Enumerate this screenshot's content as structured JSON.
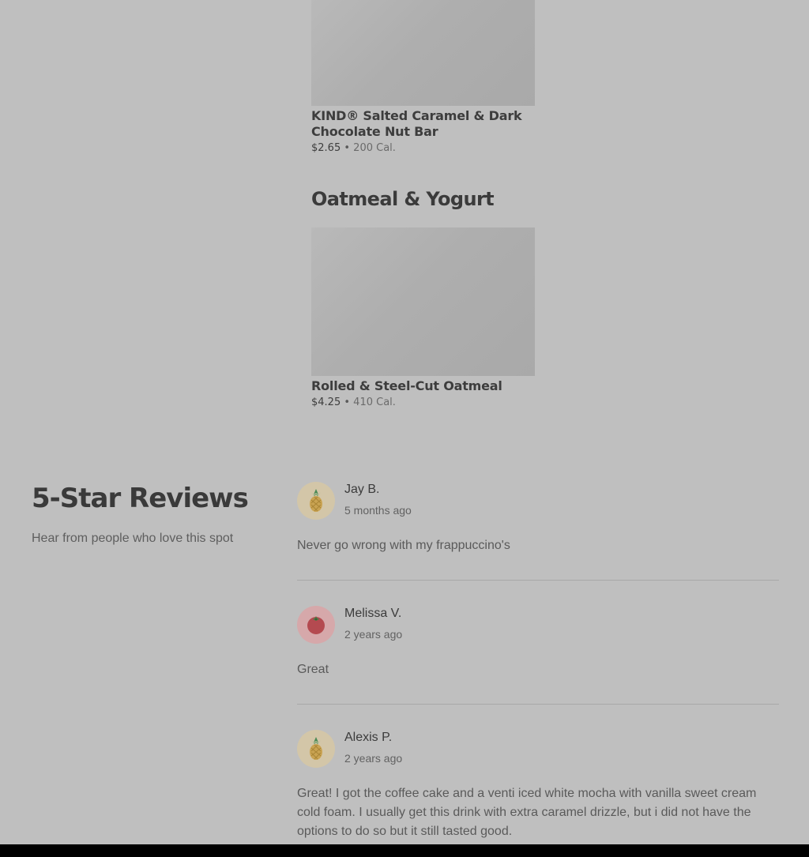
{
  "menu": {
    "items": [
      {
        "name": "KIND® Salted Caramel & Dark Chocolate Nut Bar",
        "price": "$2.65",
        "calories": "200 Cal."
      }
    ],
    "sections": [
      {
        "title": "Oatmeal & Yogurt",
        "items": [
          {
            "name": "Rolled & Steel-Cut Oatmeal",
            "price": "$4.25",
            "calories": "410 Cal."
          }
        ]
      }
    ],
    "separator": "•"
  },
  "reviews": {
    "title": "5-Star Reviews",
    "subtitle": "Hear from people who love this spot",
    "list": [
      {
        "name": "Jay B.",
        "time": "5 months ago",
        "text": "Never go wrong with my frappuccino's",
        "avatar_icon": "pineapple-icon"
      },
      {
        "name": "Melissa V.",
        "time": "2 years ago",
        "text": "Great",
        "avatar_icon": "tomato-icon"
      },
      {
        "name": "Alexis P.",
        "time": "2 years ago",
        "text": "Great! I got the coffee cake and a venti iced white mocha with vanilla sweet cream cold foam. I usually get this drink with extra caramel drizzle, but i did not have the options to do so but it still tasted good.",
        "avatar_icon": "pineapple-icon"
      }
    ]
  },
  "colors": {
    "overlay_background": "#bfbfbf",
    "text_primary": "#3b3b3b",
    "text_secondary": "#5a5a5a",
    "divider": "#a8a8a8"
  }
}
